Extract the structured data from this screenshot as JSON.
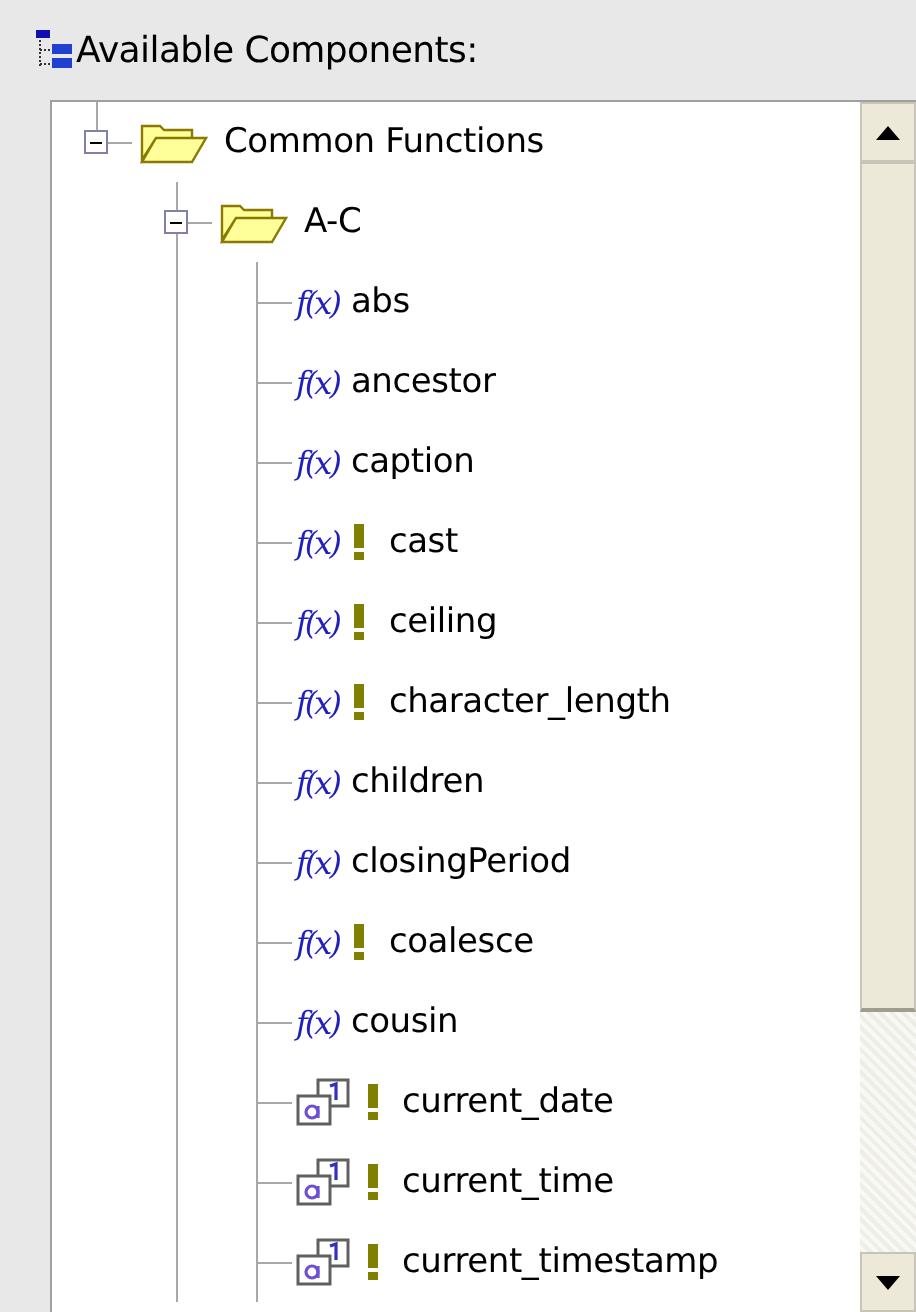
{
  "panel": {
    "title": "Available Components:"
  },
  "tree": [
    {
      "label": "Common Functions",
      "kind": "folder",
      "expanded": true,
      "children": [
        {
          "label": "A-C",
          "kind": "folder",
          "expanded": true,
          "children": [
            {
              "label": "abs",
              "kind": "function",
              "symbol": "f(x)",
              "flagged": false
            },
            {
              "label": "ancestor",
              "kind": "function",
              "symbol": "f(x)",
              "flagged": false
            },
            {
              "label": "caption",
              "kind": "function",
              "symbol": "f(x)",
              "flagged": false
            },
            {
              "label": "cast",
              "kind": "function",
              "symbol": "f(x)",
              "flagged": true
            },
            {
              "label": "ceiling",
              "kind": "function",
              "symbol": "f(x)",
              "flagged": true
            },
            {
              "label": "character_length",
              "kind": "function",
              "symbol": "f(x)",
              "flagged": true
            },
            {
              "label": "children",
              "kind": "function",
              "symbol": "f(x)",
              "flagged": false
            },
            {
              "label": "closingPeriod",
              "kind": "function",
              "symbol": "f(x)",
              "flagged": false
            },
            {
              "label": "coalesce",
              "kind": "function",
              "symbol": "f(x)",
              "flagged": true
            },
            {
              "label": "cousin",
              "kind": "function",
              "symbol": "f(x)",
              "flagged": false
            },
            {
              "label": "current_date",
              "kind": "value",
              "flagged": true
            },
            {
              "label": "current_time",
              "kind": "value",
              "flagged": true
            },
            {
              "label": "current_timestamp",
              "kind": "value",
              "flagged": true
            }
          ]
        }
      ]
    }
  ]
}
